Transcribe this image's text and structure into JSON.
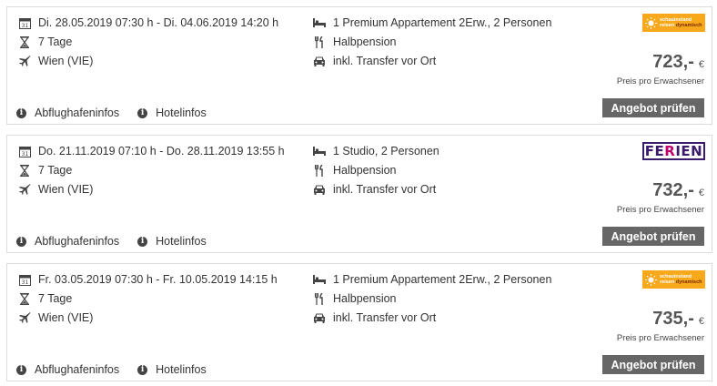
{
  "offers": [
    {
      "dates": "Di. 28.05.2019 07:30 h - Di. 04.06.2019 14:20 h",
      "duration": "7 Tage",
      "airport": "Wien (VIE)",
      "room": "1 Premium Appartement 2Erw., 2 Personen",
      "board": "Halbpension",
      "transfer": "inkl. Transfer vor Ort",
      "price": "723,-",
      "currency": "€",
      "price_note": "Preis pro Erwachsener",
      "button": "Angebot prüfen",
      "link_airport": "Abflughafeninfos",
      "link_hotel": "Hotelinfos",
      "logo": {
        "line1": "schauinsland",
        "line2": "reisen",
        "line3": "dynamisch"
      }
    },
    {
      "dates": "Do. 21.11.2019 07:10 h - Do. 28.11.2019 13:55 h",
      "duration": "7 Tage",
      "airport": "Wien (VIE)",
      "room": "1 Studio, 2 Personen",
      "board": "Halbpension",
      "transfer": "inkl. Transfer vor Ort",
      "price": "732,-",
      "currency": "€",
      "price_note": "Preis pro Erwachsener",
      "button": "Angebot prüfen",
      "link_airport": "Abflughafeninfos",
      "link_hotel": "Hotelinfos",
      "logo": {
        "a": "FE",
        "b": "R",
        "c": "IEN"
      }
    },
    {
      "dates": "Fr. 03.05.2019 07:30 h - Fr. 10.05.2019 14:15 h",
      "duration": "7 Tage",
      "airport": "Wien (VIE)",
      "room": "1 Premium Appartement 2Erw., 2 Personen",
      "board": "Halbpension",
      "transfer": "inkl. Transfer vor Ort",
      "price": "735,-",
      "currency": "€",
      "price_note": "Preis pro Erwachsener",
      "button": "Angebot prüfen",
      "link_airport": "Abflughafeninfos",
      "link_hotel": "Hotelinfos",
      "logo": {
        "line1": "schauinsland",
        "line2": "reisen",
        "line3": "dynamisch"
      }
    }
  ],
  "colors": {
    "button_bg": "#666666",
    "schauinsland_logo": "#f7a81b",
    "ferien_logo": "#3a1a6a"
  },
  "icons": [
    "calendar-icon",
    "hourglass-icon",
    "plane-icon",
    "bed-icon",
    "cutlery-icon",
    "car-icon",
    "info-icon"
  ]
}
